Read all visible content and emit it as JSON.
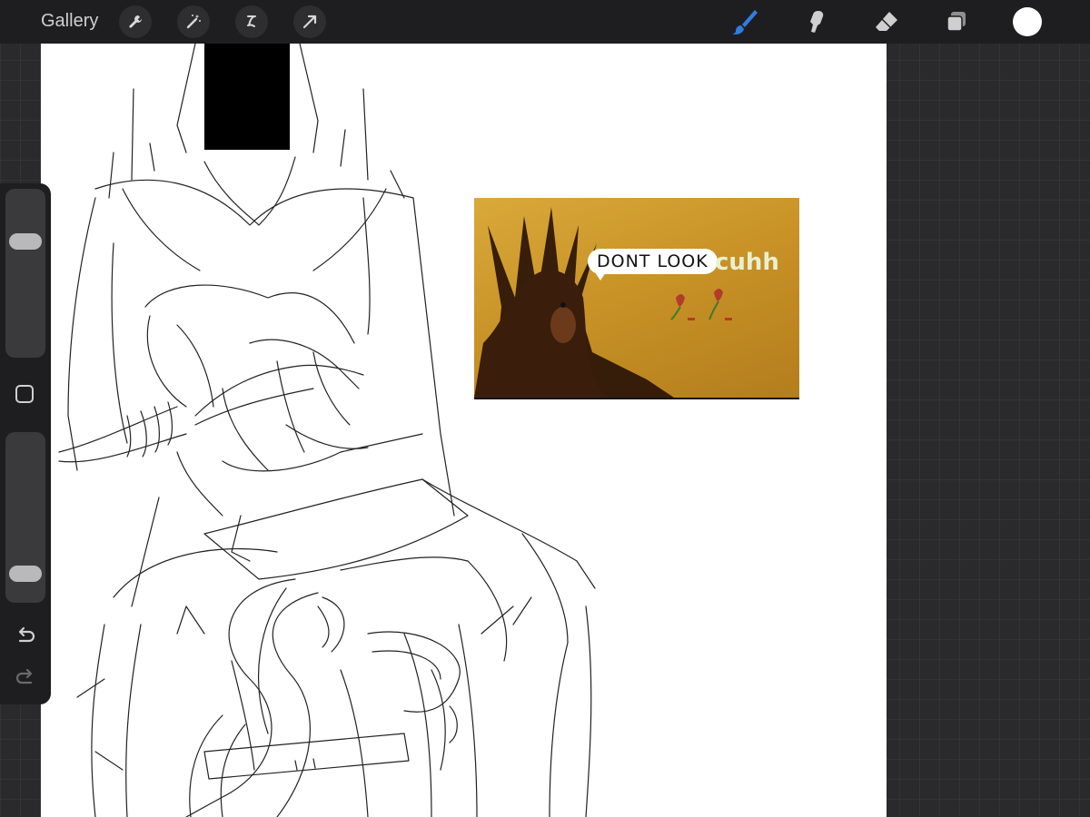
{
  "topbar": {
    "gallery_label": "Gallery",
    "left_tools": [
      "wrench-icon",
      "magic-wand-icon",
      "selection-icon",
      "transform-arrow-icon"
    ],
    "right_tools": [
      "brush-icon",
      "smudge-icon",
      "eraser-icon",
      "layers-icon"
    ],
    "active_tool": "brush",
    "active_color": "#ffffff",
    "accent_color": "#2f7de1"
  },
  "canvas": {
    "meme": {
      "bubble_text": "DONT LOOK",
      "caption": "cuhh"
    }
  },
  "sidebar": {
    "brush_size_level": 0.72,
    "opacity_level": 0.12,
    "icons": [
      "modify-square-icon",
      "undo-icon",
      "redo-icon"
    ]
  }
}
